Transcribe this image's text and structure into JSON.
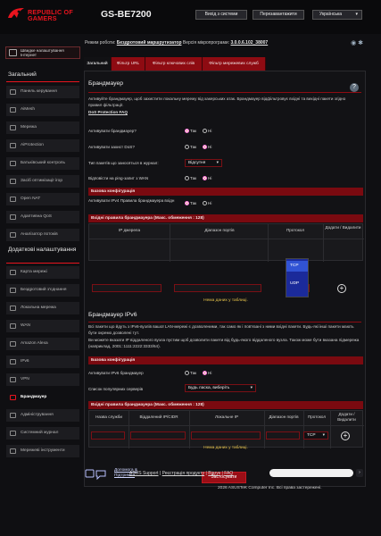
{
  "header": {
    "brand_line1": "REPUBLIC OF",
    "brand_line2": "GAMERS",
    "model": "GS-BE7200",
    "logout": "Вихід з системи",
    "reboot": "Перезавантажити",
    "language": "Українська"
  },
  "sidebar": {
    "quick_setup": "Швидке налаштування Інтернет",
    "section_general": "Загальний",
    "general_items": [
      "Панель керування",
      "AiMesh",
      "Мережа",
      "AiProtection",
      "Батьківський контроль",
      "Засіб оптимізації ігор",
      "Open NAT",
      "Адаптивна QoS",
      "Аналізатор потоків"
    ],
    "section_advanced": "Додаткові налаштування",
    "advanced_items": [
      "Карта мережі",
      "Бездротовий з'єднання",
      "Локальна мережа",
      "WAN",
      "Amazon Alexa",
      "IPv6",
      "VPN",
      "Брандмауер",
      "Адміністрування",
      "Системний журнал",
      "Мережеві інструменти"
    ]
  },
  "main": {
    "fw_mode_label": "Режим роботи:",
    "fw_mode_value": "Бездротовий маршрутизатор",
    "fw_version_label": "Версія мікропрограми:",
    "fw_version_value": "3.0.0.6.102_38007",
    "tabs": [
      "Загальний",
      "Фільтр URL",
      "Фільтр ключових слів",
      "Фільтр мережевих служб"
    ],
    "title_firewall": "Брандмауер",
    "desc_firewall": "Активуйте брандмауер, щоб захистити локальну мережу від хакерських атак. Брандмауер відфільтровує вхідні та вихідні пакети згідно правил фільтрації.",
    "faq_link": "DoS Protection FAQ",
    "rows": [
      {
        "label": "Активувати брандмауер?",
        "yes": "Так",
        "no": "Ні",
        "selected": "yes"
      },
      {
        "label": "Активувати захист DoS?",
        "yes": "Так",
        "no": "Ні",
        "selected": "no"
      },
      {
        "label": "Тип пакетів що заносяться в журнал:",
        "select": "Відсутня"
      },
      {
        "label": "Відповісти на ping-запит з WAN",
        "yes": "Так",
        "no": "Ні",
        "selected": "no"
      }
    ],
    "basic_config": "Базова конфігурація",
    "ipv4_inbound_label": "Активувати IPv4 Правила брандмауера вхідн",
    "ipv4_yes": "Так",
    "ipv4_no": "Ні",
    "ipv4_list_title": "Вхідні правила брандмауера (Макс. обмеження : 128)",
    "ipv4_cols": [
      "IP джерела",
      "Діапазон портів",
      "Протокол",
      "Додати / Видалити"
    ],
    "protocol_value": "TCP",
    "no_data": "Нема даних у таблиці.",
    "dropdown_options": [
      "TCP",
      "UDP"
    ],
    "title_ipv6": "Брандмауер IPv6",
    "desc_ipv6_1": "Всі пакети що йдуть з IPv6-вузлів вашої LAN-мережі є дозволеними, так само як і пов'язані з ними вхідні пакети. Будь-які інші пакети мають бути окремо дозволені тут.",
    "desc_ipv6_2": "Ви можете вказати IP віддаленого вузла пустим щоб дозволити пакети від будь-якого віддаленого вузла. Також може бути вказана підмережа (наприклад, 2001::1111:2222:3333/64).",
    "basic_config_2": "Базова конфігурація",
    "ipv6_enable_label": "Активувати IPv6 брандмауер",
    "ipv6_yes": "Так",
    "ipv6_no": "Ні",
    "popular_servers_label": "Список популярних серверів",
    "popular_servers_value": "Будь ласка, виберіть",
    "ipv6_list_title": "Вхідні правила брандмауера (Макс. обмеження : 128)",
    "ipv6_cols": [
      "Назва служби",
      "Віддалений IP/CIDR",
      "Локальне IP",
      "Діапазон портів",
      "Протокол",
      "Додати / Видалити"
    ],
    "protocol_value_2": "TCP",
    "no_data_2": "Нема даних у таблиці.",
    "apply": "Застосувати"
  },
  "footer": {
    "help_line1": "Допомога &",
    "help_line2": "Підтримка",
    "support": "ASUS Support",
    "register": "Реєстрація продукту",
    "feedback": "Відгук",
    "faq": "FAQ",
    "copyright": "2026 ASUSTeK Computer Inc. Всі права застережені."
  }
}
